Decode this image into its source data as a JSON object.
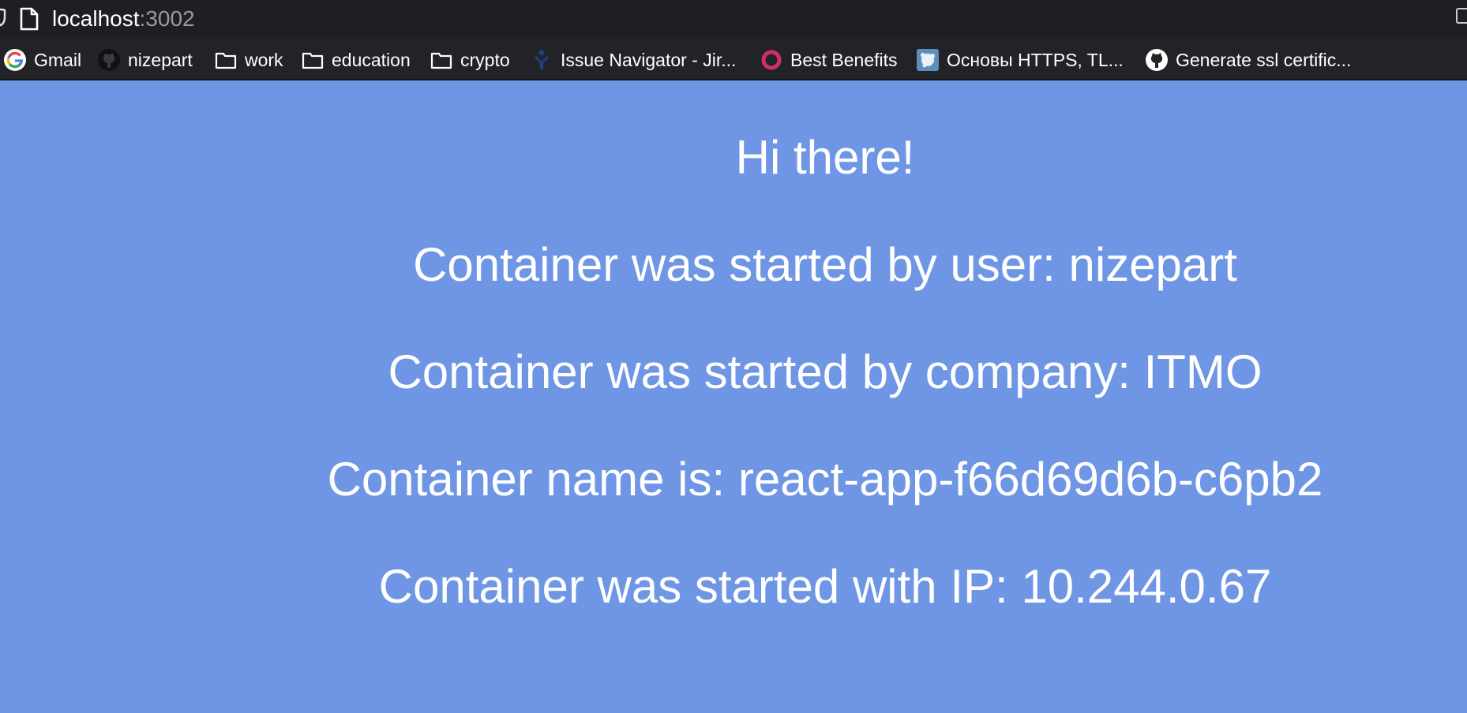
{
  "browser": {
    "url_host": "localhost",
    "url_port": ":3002",
    "bookmarks": [
      {
        "label": "Gmail",
        "icon": "google-icon"
      },
      {
        "label": "nizepart",
        "icon": "github-icon"
      },
      {
        "label": "work",
        "icon": "folder-icon"
      },
      {
        "label": "education",
        "icon": "folder-icon"
      },
      {
        "label": "crypto",
        "icon": "folder-icon"
      },
      {
        "label": "Issue Navigator - Jir...",
        "icon": "jira-icon"
      },
      {
        "label": "Best Benefits",
        "icon": "best-benefits-icon"
      },
      {
        "label": "Основы HTTPS, TL...",
        "icon": "site-favicon-icon"
      },
      {
        "label": "Generate ssl certific...",
        "icon": "github-icon"
      }
    ]
  },
  "page": {
    "background_color": "#6f96e5",
    "greeting": "Hi there!",
    "user_line": "Container was started by user: nizepart",
    "company_line": "Container was started by company: ITMO",
    "name_line": "Container name is: react-app-f66d69d6b-c6pb2",
    "ip_line": "Container was started with IP: 10.244.0.67"
  }
}
